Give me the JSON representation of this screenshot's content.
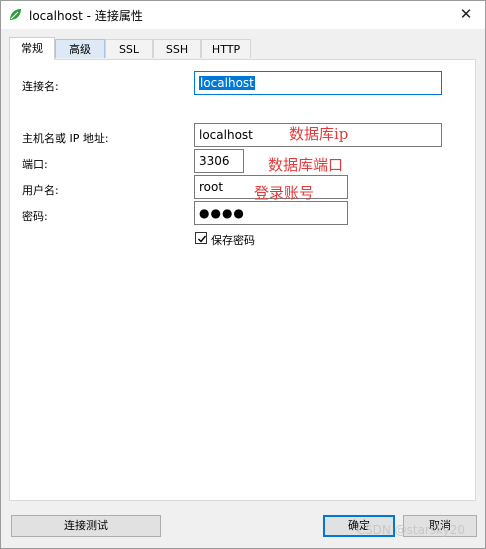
{
  "window": {
    "title": "localhost - 连接属性",
    "close_glyph": "✕",
    "icon": "navicat-leaf-icon",
    "accent": "#0078d7"
  },
  "tabs": [
    {
      "label": "常规",
      "active": true
    },
    {
      "label": "高级"
    },
    {
      "label": "SSL"
    },
    {
      "label": "SSH"
    },
    {
      "label": "HTTP"
    }
  ],
  "form": {
    "connection_name": {
      "label": "连接名:",
      "value": "localhost"
    },
    "host": {
      "label": "主机名或 IP 地址:",
      "value": "localhost"
    },
    "port": {
      "label": "端口:",
      "value": "3306"
    },
    "username": {
      "label": "用户名:",
      "value": "root"
    },
    "password": {
      "label": "密码:",
      "value": "●●●●"
    },
    "save_password": {
      "label": "保存密码",
      "checked": true
    }
  },
  "annotations": {
    "host": "数据库ip",
    "port": "数据库端口",
    "username": "登录账号",
    "color": "#e23b3b"
  },
  "buttons": {
    "test": "连接测试",
    "ok": "确定",
    "cancel": "取消"
  },
  "watermark": "CSDN @starsky20"
}
